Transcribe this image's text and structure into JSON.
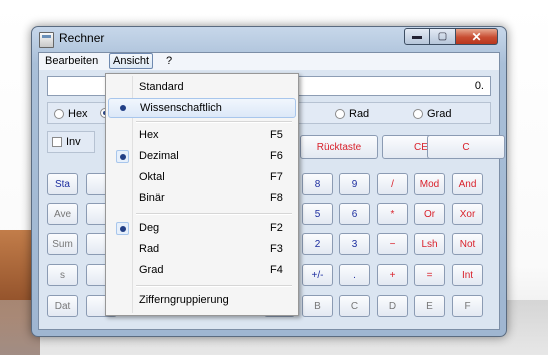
{
  "window": {
    "title": "Rechner"
  },
  "controls": {
    "minimize": "▬",
    "maximize": "▢",
    "close": "✕"
  },
  "menubar": {
    "items": [
      "Bearbeiten",
      "Ansicht",
      "?"
    ]
  },
  "display": {
    "value": "0."
  },
  "radios": {
    "hex": "Hex",
    "rad": "Rad",
    "grad": "Grad"
  },
  "inv": {
    "label": "Inv"
  },
  "top_buttons": {
    "backspace": "Rücktaste",
    "ce": "CE",
    "c": "C"
  },
  "left_buttons": [
    "Sta",
    "Ave",
    "Sum",
    "s",
    "Dat"
  ],
  "digits": {
    "row1": [
      "8",
      "9",
      "/",
      "Mod",
      "And"
    ],
    "row2": [
      "5",
      "6",
      "*",
      "Or",
      "Xor"
    ],
    "row3": [
      "2",
      "3",
      "−",
      "Lsh",
      "Not"
    ],
    "row4": [
      "+/-",
      ".",
      "+",
      "=",
      "Int"
    ],
    "row5": [
      "B",
      "C",
      "D",
      "E",
      "F"
    ]
  },
  "menu": {
    "standard": "Standard",
    "scientific": "Wissenschaftlich",
    "hex": {
      "label": "Hex",
      "shortcut": "F5"
    },
    "dezimal": {
      "label": "Dezimal",
      "shortcut": "F6"
    },
    "oktal": {
      "label": "Oktal",
      "shortcut": "F7"
    },
    "binaer": {
      "label": "Binär",
      "shortcut": "F8"
    },
    "deg": {
      "label": "Deg",
      "shortcut": "F2"
    },
    "rad": {
      "label": "Rad",
      "shortcut": "F3"
    },
    "grad": {
      "label": "Grad",
      "shortcut": "F4"
    },
    "grouping": "Zifferngruppierung"
  }
}
